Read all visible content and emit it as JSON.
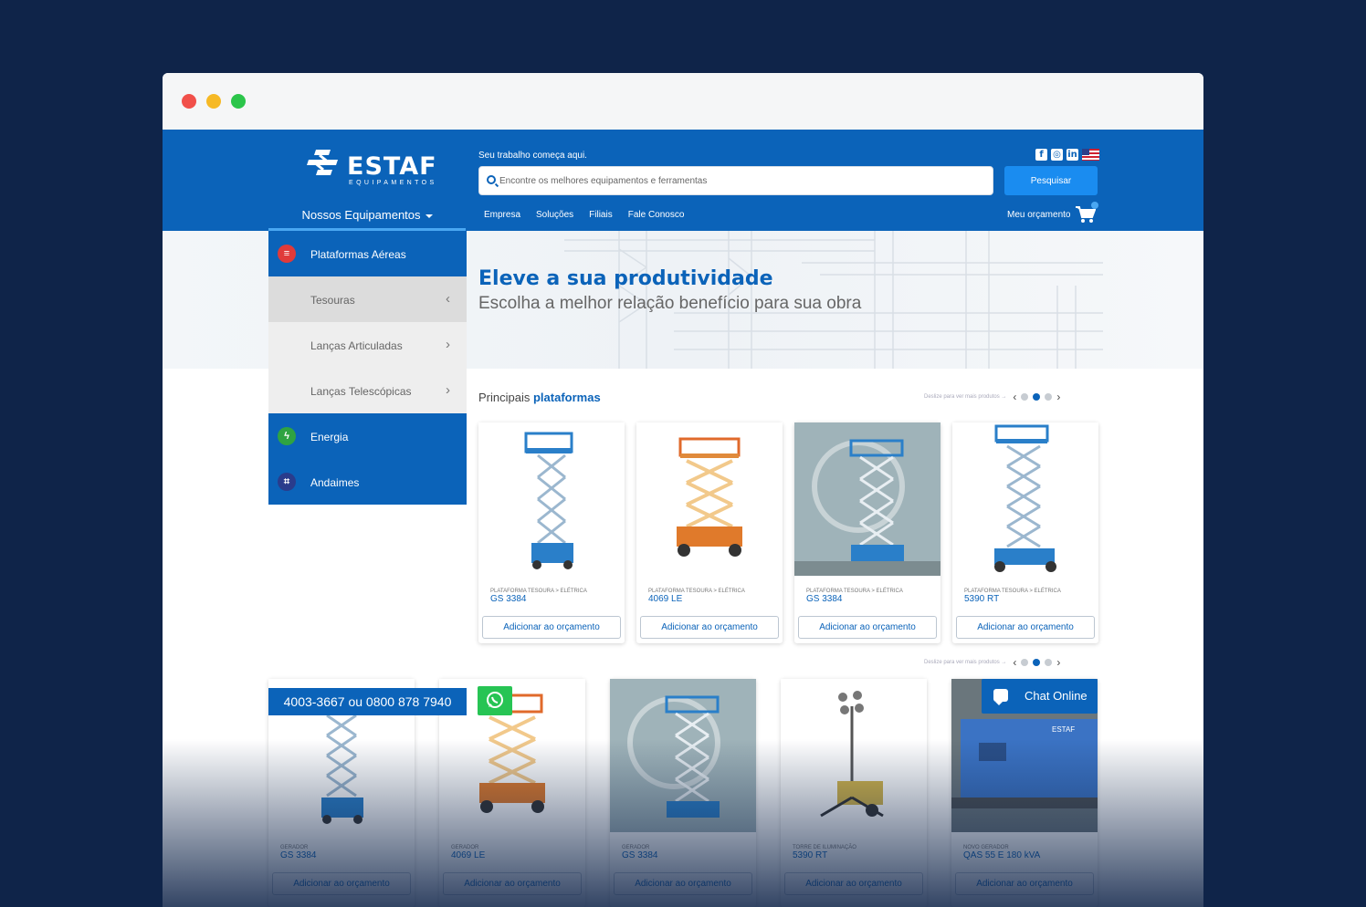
{
  "header": {
    "logo_text": "ESTAF",
    "logo_sub": "EQUIPAMENTOS",
    "tagline": "Seu trabalho começa aqui.",
    "search_placeholder": "Encontre os melhores equipamentos e ferramentas",
    "search_button": "Pesquisar",
    "equipment_menu": "Nossos Equipamentos",
    "nav": [
      "Empresa",
      "Soluções",
      "Filiais",
      "Fale Conosco"
    ],
    "budget_label": "Meu orçamento",
    "social": [
      "facebook-icon",
      "instagram-icon",
      "linkedin-icon",
      "us-flag-icon"
    ]
  },
  "sidebar": {
    "items": [
      {
        "label": "Plataformas Aéreas",
        "type": "main",
        "icon": "platform-icon",
        "color": "#e03a3a"
      },
      {
        "label": "Tesouras",
        "type": "sub",
        "active": true
      },
      {
        "label": "Lanças Articuladas",
        "type": "sub"
      },
      {
        "label": "Lanças Telescópicas",
        "type": "sub"
      },
      {
        "label": "Energia",
        "type": "main",
        "icon": "bolt-icon",
        "color": "#2fa341"
      },
      {
        "label": "Andaimes",
        "type": "main",
        "icon": "scaffold-icon",
        "color": "#2a3c8c"
      }
    ]
  },
  "hero": {
    "title": "Eleve a sua produtividade",
    "subtitle": "Escolha a melhor relação benefício para sua obra"
  },
  "section": {
    "title_prefix": "Principais",
    "title_highlight": "plataformas",
    "pager_hint": "Deslize para ver mais produtos →"
  },
  "products": [
    {
      "category": "PLATAFORMA TESOURA > ELÉTRICA",
      "model": "GS 3384",
      "button": "Adicionar ao orçamento"
    },
    {
      "category": "PLATAFORMA TESOURA > ELÉTRICA",
      "model": "4069 LE",
      "button": "Adicionar ao orçamento"
    },
    {
      "category": "PLATAFORMA TESOURA > ELÉTRICA",
      "model": "GS 3384",
      "button": "Adicionar ao orçamento"
    },
    {
      "category": "PLATAFORMA TESOURA > ELÉTRICA",
      "model": "5390 RT",
      "button": "Adicionar ao orçamento"
    }
  ],
  "products_row2": [
    {
      "category": "GERADOR",
      "model": "GS 3384",
      "button": "Adicionar ao orçamento"
    },
    {
      "category": "GERADOR",
      "model": "4069 LE",
      "button": "Adicionar ao orçamento"
    },
    {
      "category": "GERADOR",
      "model": "GS 3384",
      "button": "Adicionar ao orçamento"
    },
    {
      "category": "TORRE DE ILUMINAÇÃO",
      "model": "5390 RT",
      "button": "Adicionar ao orçamento"
    },
    {
      "category": "NOVO GERADOR",
      "model": "QAS 55 E 180 kVA",
      "button": "Adicionar ao orçamento"
    }
  ],
  "floating": {
    "phone": "4003-3667 ou 0800 878 7940",
    "chat": "Chat Online"
  },
  "colors": {
    "brand_blue": "#0b63b9",
    "accent_blue": "#1a8cf0",
    "background": "#0f2449"
  }
}
